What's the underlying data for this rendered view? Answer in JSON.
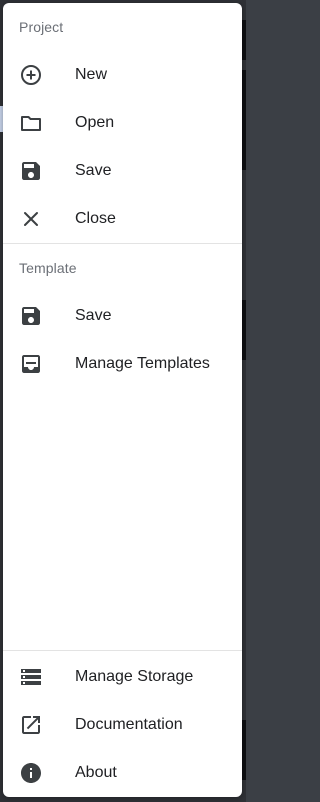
{
  "drawer": {
    "project": {
      "header": "Project",
      "items": [
        {
          "label": "New",
          "icon": "add-circle-icon"
        },
        {
          "label": "Open",
          "icon": "folder-icon"
        },
        {
          "label": "Save",
          "icon": "save-icon"
        },
        {
          "label": "Close",
          "icon": "close-icon"
        }
      ]
    },
    "template": {
      "header": "Template",
      "items": [
        {
          "label": "Save",
          "icon": "save-icon"
        },
        {
          "label": "Manage Templates",
          "icon": "inbox-icon"
        }
      ]
    },
    "footer": {
      "items": [
        {
          "label": "Manage Storage",
          "icon": "storage-icon"
        },
        {
          "label": "Documentation",
          "icon": "open-in-new-icon"
        },
        {
          "label": "About",
          "icon": "info-icon"
        }
      ]
    }
  },
  "colors": {
    "text": "#202124",
    "subheader": "#6b6f76",
    "icon": "#3c4043",
    "divider": "#e3e3e3"
  }
}
